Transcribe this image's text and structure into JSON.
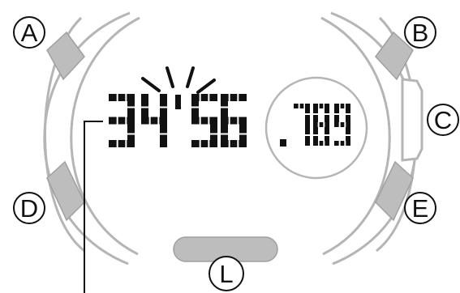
{
  "watch": {
    "display": {
      "main_digits": "3456",
      "minutes": "34",
      "seconds": "56",
      "sub_digits": ".789",
      "sub_decimal": ".",
      "sub_numbers": "789"
    },
    "buttons": [
      {
        "key": "A",
        "label": "A"
      },
      {
        "key": "B",
        "label": "B"
      },
      {
        "key": "C",
        "label": "C"
      },
      {
        "key": "D",
        "label": "D"
      },
      {
        "key": "E",
        "label": "E"
      },
      {
        "key": "L",
        "label": "L"
      }
    ],
    "colors": {
      "outline": "#b5b5b5",
      "button_fill": "#bdbdbd",
      "digit": "#111111",
      "ink": "#111111"
    }
  }
}
